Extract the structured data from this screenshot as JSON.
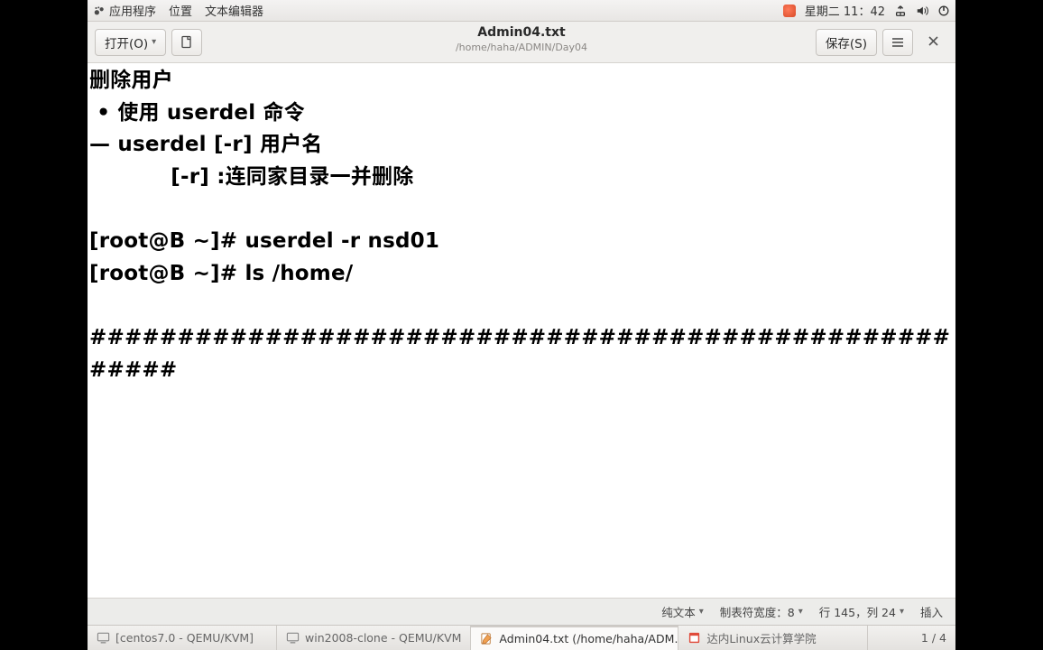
{
  "topbar": {
    "applications": "应用程序",
    "places": "位置",
    "app_name": "文本编辑器",
    "clock": "星期二 11：42"
  },
  "toolbar": {
    "open_label": "打开(O)",
    "save_label": "保存(S)",
    "title": "Admin04.txt",
    "path": "/home/haha/ADMIN/Day04"
  },
  "editor": {
    "content": "删除用户\n • 使用 userdel 命令\n— userdel [-r] 用户名\n           [-r] :连同家目录一并删除\n\n[root@B ~]# userdel -r nsd01\n[root@B ~]# ls /home/\n\n######################################################"
  },
  "statusbar": {
    "syntax": "纯文本",
    "tab_width": "制表符宽度：8",
    "cursor": "行 145，列 24",
    "insert_mode": "插入"
  },
  "taskbar": {
    "items": [
      {
        "label": "[centos7.0 - QEMU/KVM]",
        "icon": "monitor"
      },
      {
        "label": "win2008-clone - QEMU/KVM",
        "icon": "monitor"
      },
      {
        "label": "Admin04.txt (/home/haha/ADM…",
        "icon": "editor"
      },
      {
        "label": "达内Linux云计算学院",
        "icon": "browser"
      }
    ]
  },
  "pager": {
    "current": "1",
    "total": "4"
  }
}
